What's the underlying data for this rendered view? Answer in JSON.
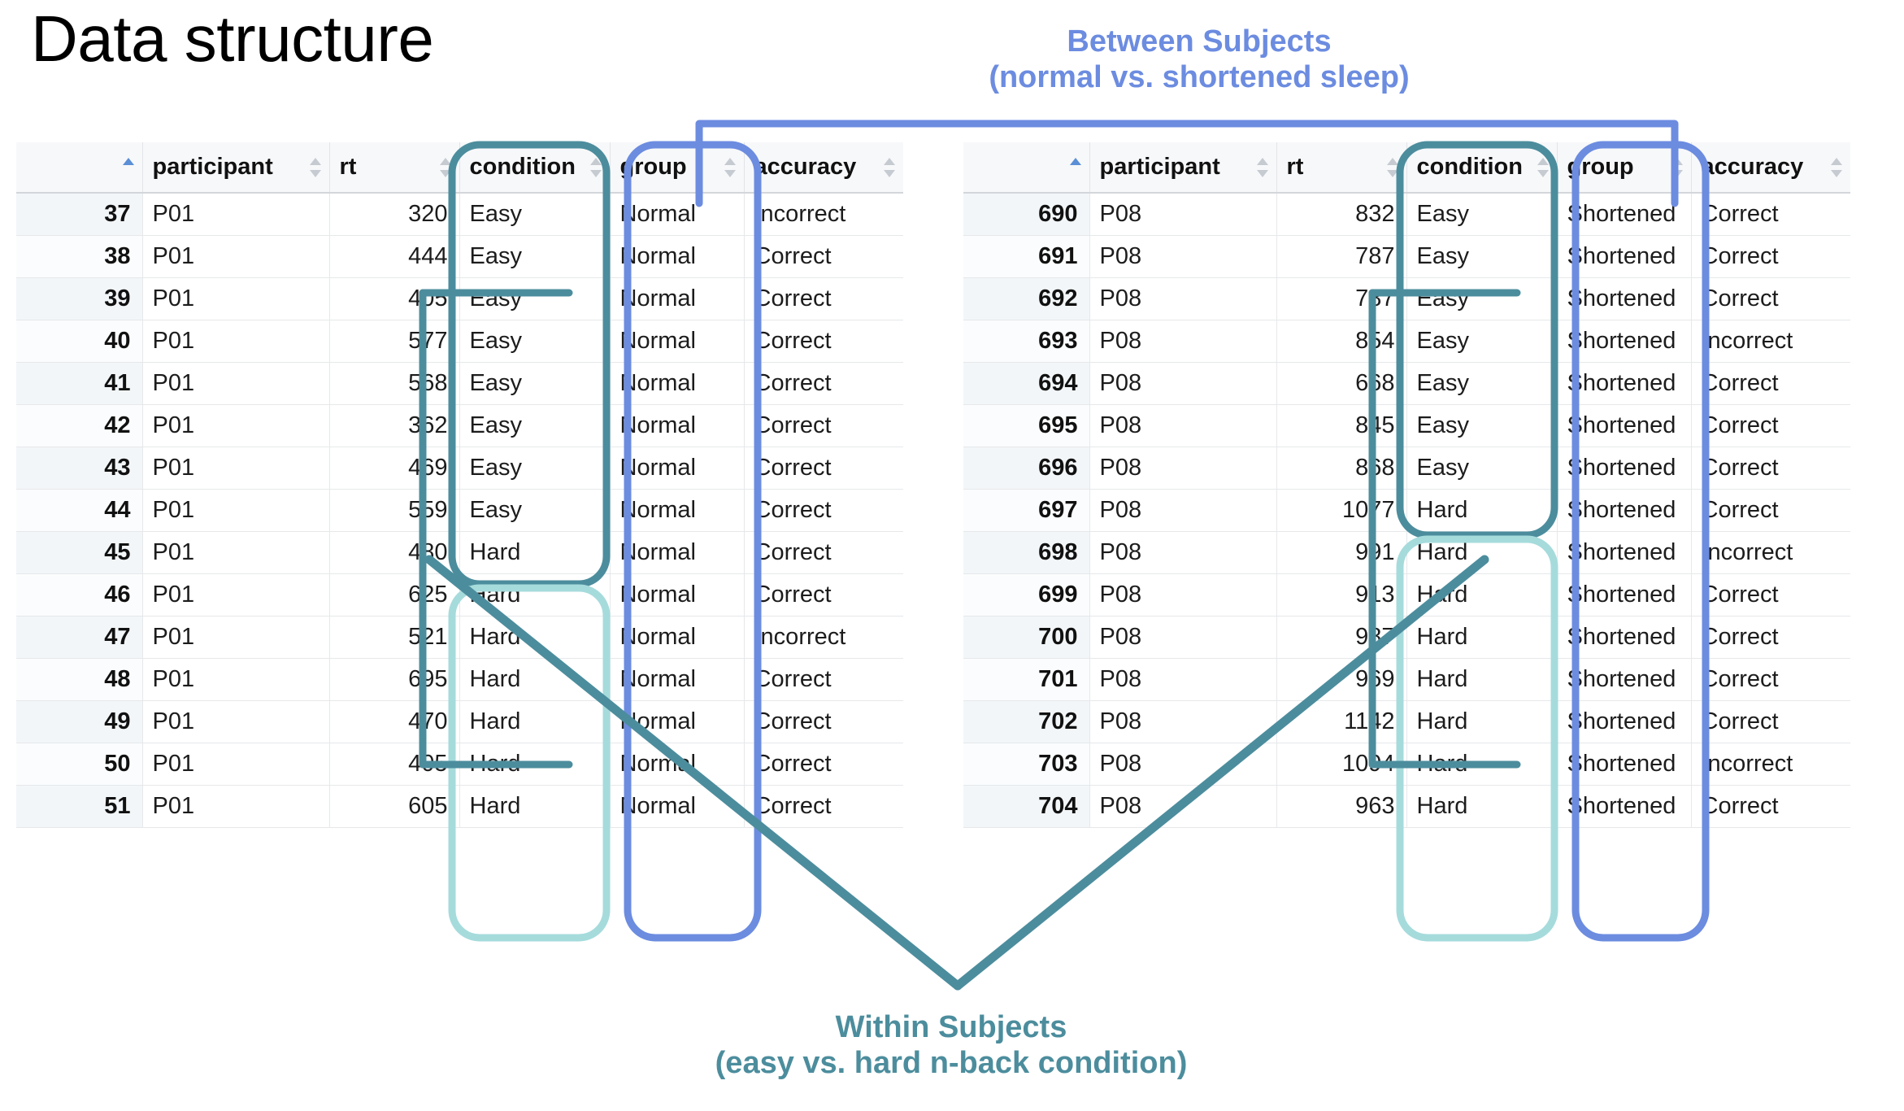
{
  "page_title": "Data structure",
  "annotations": {
    "between": {
      "line1": "Between Subjects",
      "line2": "(normal vs. shortened sleep)",
      "color": "#6c8ce0"
    },
    "within": {
      "line1": "Within Subjects",
      "line2": "(easy vs. hard n-back condition)",
      "color": "#4c8d9d"
    }
  },
  "colors": {
    "between_blue": "#6c8ce0",
    "within_teal_dark": "#4c8d9d",
    "within_teal_light": "#a6dbdc",
    "header_bg": "#f7f8fa",
    "sort_active": "#5b8fd6"
  },
  "tables": {
    "left": {
      "columns": [
        "",
        "participant",
        "rt",
        "condition",
        "group",
        "accuracy"
      ],
      "rows": [
        {
          "idx": "37",
          "participant": "P01",
          "rt": "320",
          "condition": "Easy",
          "group": "Normal",
          "accuracy": "Incorrect"
        },
        {
          "idx": "38",
          "participant": "P01",
          "rt": "444",
          "condition": "Easy",
          "group": "Normal",
          "accuracy": "Correct"
        },
        {
          "idx": "39",
          "participant": "P01",
          "rt": "405",
          "condition": "Easy",
          "group": "Normal",
          "accuracy": "Correct"
        },
        {
          "idx": "40",
          "participant": "P01",
          "rt": "577",
          "condition": "Easy",
          "group": "Normal",
          "accuracy": "Correct"
        },
        {
          "idx": "41",
          "participant": "P01",
          "rt": "568",
          "condition": "Easy",
          "group": "Normal",
          "accuracy": "Correct"
        },
        {
          "idx": "42",
          "participant": "P01",
          "rt": "362",
          "condition": "Easy",
          "group": "Normal",
          "accuracy": "Correct"
        },
        {
          "idx": "43",
          "participant": "P01",
          "rt": "469",
          "condition": "Easy",
          "group": "Normal",
          "accuracy": "Correct"
        },
        {
          "idx": "44",
          "participant": "P01",
          "rt": "559",
          "condition": "Easy",
          "group": "Normal",
          "accuracy": "Correct"
        },
        {
          "idx": "45",
          "participant": "P01",
          "rt": "480",
          "condition": "Hard",
          "group": "Normal",
          "accuracy": "Correct"
        },
        {
          "idx": "46",
          "participant": "P01",
          "rt": "625",
          "condition": "Hard",
          "group": "Normal",
          "accuracy": "Correct"
        },
        {
          "idx": "47",
          "participant": "P01",
          "rt": "521",
          "condition": "Hard",
          "group": "Normal",
          "accuracy": "Incorrect"
        },
        {
          "idx": "48",
          "participant": "P01",
          "rt": "695",
          "condition": "Hard",
          "group": "Normal",
          "accuracy": "Correct"
        },
        {
          "idx": "49",
          "participant": "P01",
          "rt": "470",
          "condition": "Hard",
          "group": "Normal",
          "accuracy": "Correct"
        },
        {
          "idx": "50",
          "participant": "P01",
          "rt": "405",
          "condition": "Hard",
          "group": "Normal",
          "accuracy": "Correct"
        },
        {
          "idx": "51",
          "participant": "P01",
          "rt": "605",
          "condition": "Hard",
          "group": "Normal",
          "accuracy": "Correct"
        }
      ]
    },
    "right": {
      "columns": [
        "",
        "participant",
        "rt",
        "condition",
        "group",
        "accuracy"
      ],
      "rows": [
        {
          "idx": "690",
          "participant": "P08",
          "rt": "832",
          "condition": "Easy",
          "group": "Shortened",
          "accuracy": "Correct"
        },
        {
          "idx": "691",
          "participant": "P08",
          "rt": "787",
          "condition": "Easy",
          "group": "Shortened",
          "accuracy": "Correct"
        },
        {
          "idx": "692",
          "participant": "P08",
          "rt": "787",
          "condition": "Easy",
          "group": "Shortened",
          "accuracy": "Correct"
        },
        {
          "idx": "693",
          "participant": "P08",
          "rt": "854",
          "condition": "Easy",
          "group": "Shortened",
          "accuracy": "Incorrect"
        },
        {
          "idx": "694",
          "participant": "P08",
          "rt": "668",
          "condition": "Easy",
          "group": "Shortened",
          "accuracy": "Correct"
        },
        {
          "idx": "695",
          "participant": "P08",
          "rt": "845",
          "condition": "Easy",
          "group": "Shortened",
          "accuracy": "Correct"
        },
        {
          "idx": "696",
          "participant": "P08",
          "rt": "868",
          "condition": "Easy",
          "group": "Shortened",
          "accuracy": "Correct"
        },
        {
          "idx": "697",
          "participant": "P08",
          "rt": "1077",
          "condition": "Hard",
          "group": "Shortened",
          "accuracy": "Correct"
        },
        {
          "idx": "698",
          "participant": "P08",
          "rt": "991",
          "condition": "Hard",
          "group": "Shortened",
          "accuracy": "Incorrect"
        },
        {
          "idx": "699",
          "participant": "P08",
          "rt": "913",
          "condition": "Hard",
          "group": "Shortened",
          "accuracy": "Correct"
        },
        {
          "idx": "700",
          "participant": "P08",
          "rt": "987",
          "condition": "Hard",
          "group": "Shortened",
          "accuracy": "Correct"
        },
        {
          "idx": "701",
          "participant": "P08",
          "rt": "969",
          "condition": "Hard",
          "group": "Shortened",
          "accuracy": "Correct"
        },
        {
          "idx": "702",
          "participant": "P08",
          "rt": "1142",
          "condition": "Hard",
          "group": "Shortened",
          "accuracy": "Correct"
        },
        {
          "idx": "703",
          "participant": "P08",
          "rt": "1094",
          "condition": "Hard",
          "group": "Shortened",
          "accuracy": "Incorrect"
        },
        {
          "idx": "704",
          "participant": "P08",
          "rt": "963",
          "condition": "Hard",
          "group": "Shortened",
          "accuracy": "Correct"
        }
      ]
    }
  }
}
